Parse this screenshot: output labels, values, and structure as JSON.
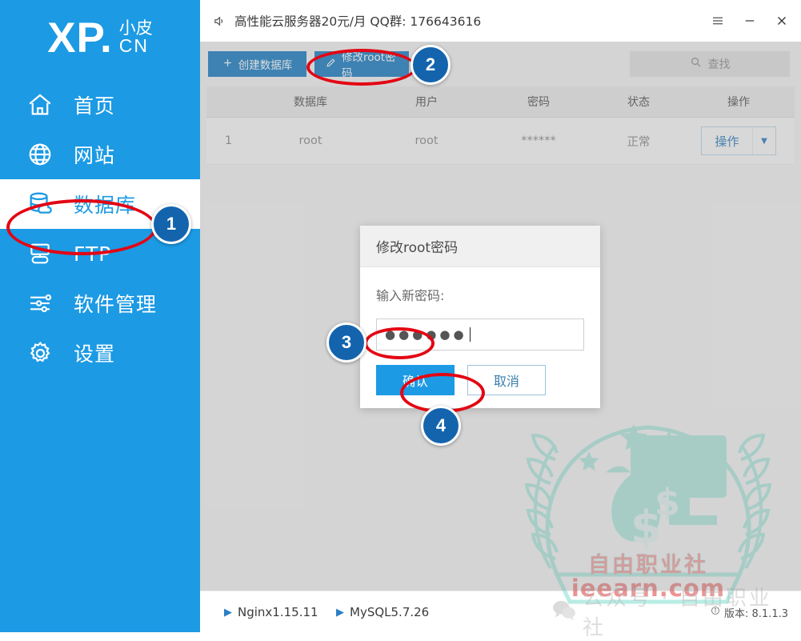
{
  "sidebar": {
    "logo": {
      "main": "XP.",
      "sub_top": "小皮",
      "sub_bottom": "CN"
    },
    "items": [
      {
        "label": "首页",
        "icon": "home-icon",
        "active": false
      },
      {
        "label": "网站",
        "icon": "globe-icon",
        "active": false
      },
      {
        "label": "数据库",
        "icon": "database-icon",
        "active": true
      },
      {
        "label": "FTP",
        "icon": "ftp-icon",
        "active": false
      },
      {
        "label": "软件管理",
        "icon": "sliders-icon",
        "active": false
      },
      {
        "label": "设置",
        "icon": "gear-icon",
        "active": false
      }
    ]
  },
  "titlebar": {
    "speaker_icon": "speaker-icon",
    "text": "高性能云服务器20元/月  QQ群: 176643616",
    "menu_icon": "hamburger-icon",
    "minimize_icon": "minimize-icon",
    "close_icon": "close-icon"
  },
  "toolbar": {
    "create_db_label": "创建数据库",
    "create_db_icon": "plus-icon",
    "edit_root_label": "修改root密码",
    "edit_root_icon": "pencil-icon",
    "search_placeholder": "查找",
    "search_icon": "search-icon"
  },
  "table": {
    "columns": [
      "",
      "数据库",
      "用户",
      "密码",
      "状态",
      "操作"
    ],
    "rows": [
      {
        "index": "1",
        "database": "root",
        "user": "root",
        "password": "******",
        "state": "正常",
        "action_label": "操作",
        "action_caret": "▼"
      }
    ]
  },
  "modal": {
    "title": "修改root密码",
    "label": "输入新密码:",
    "password_value": "●●●●●●",
    "confirm_label": "确认",
    "cancel_label": "取消"
  },
  "statusbar": {
    "nginx": "Nginx1.15.11",
    "mysql": "MySQL5.7.26",
    "play_icon": "play-icon",
    "info_icon": "info-icon",
    "version": "版本: 8.1.1.3"
  },
  "annotations": {
    "badges": [
      "1",
      "2",
      "3",
      "4"
    ]
  },
  "watermark": {
    "brand_cn": "自由职业社",
    "url": "ieearn.com",
    "bottom_text": "公众号 · 自由职业社",
    "chat_icon": "wechat-icon",
    "color": "#7fdfd0"
  }
}
